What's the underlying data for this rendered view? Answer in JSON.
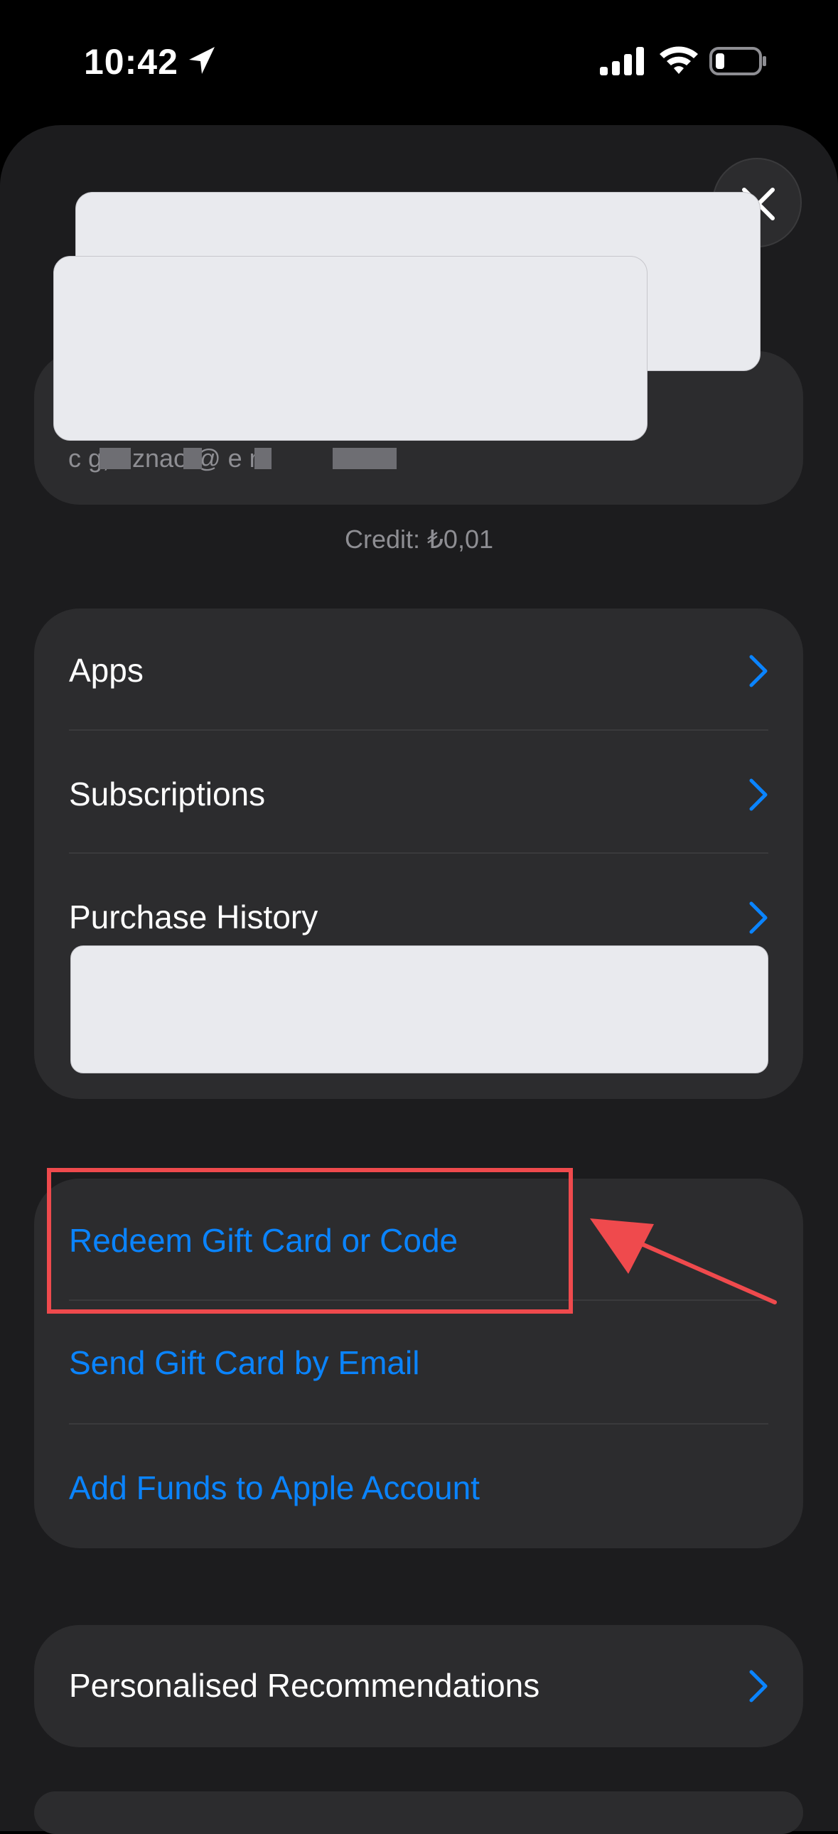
{
  "status_bar": {
    "time": "10:42"
  },
  "account": {
    "email_fragment": "c  g, r  znao  @  e  m",
    "credit": "Credit: ₺0,01"
  },
  "menu": {
    "apps": "Apps",
    "subscriptions": "Subscriptions",
    "purchase_history": "Purchase History"
  },
  "gifts": {
    "redeem": "Redeem Gift Card or Code",
    "send": "Send Gift Card by Email",
    "add_funds": "Add Funds to Apple Account"
  },
  "prefs": {
    "personalised": "Personalised Recommendations"
  },
  "colors": {
    "accent": "#0a84ff",
    "background": "#1c1c1e",
    "card": "#2c2c2e",
    "annotation": "#ef4a4d"
  }
}
